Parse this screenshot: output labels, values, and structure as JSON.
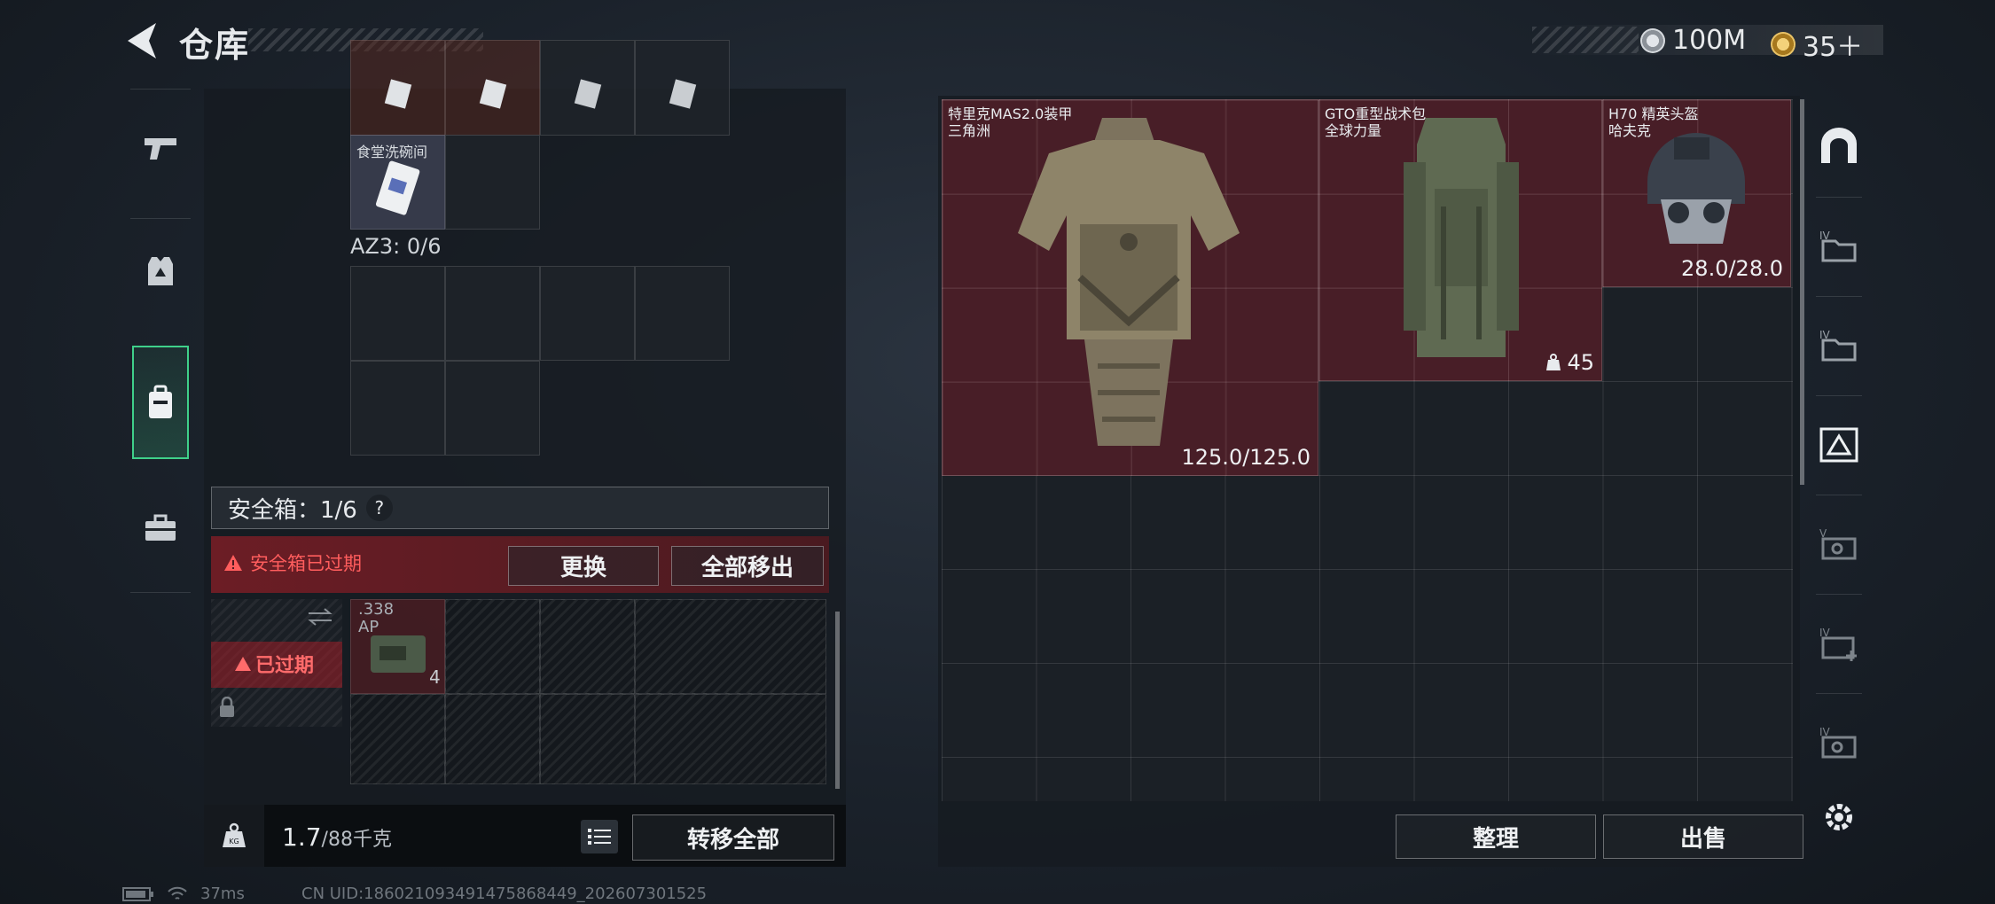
{
  "header": {
    "title": "仓库"
  },
  "currency": {
    "silver": "100M",
    "gold": "35＋"
  },
  "left_panel": {
    "item_dish": {
      "name": "食堂洗碗间"
    },
    "az3_label": "AZ3: 0/6",
    "safe_box": {
      "label": "安全箱：1/6",
      "help": "?"
    },
    "warning": {
      "text": "安全箱已过期",
      "replace": "更换",
      "move_all_out": "全部移出"
    },
    "expired_badge": "已过期",
    "ammo": {
      "label_line1": ".338",
      "label_line2": "AP",
      "count": "4"
    },
    "weight": {
      "value": "1.7",
      "unit": "/88千克"
    },
    "transfer_all": "转移全部"
  },
  "storage": {
    "items": [
      {
        "name": "特里克MAS2.0装甲",
        "sub": "三角洲",
        "durability": "125.0/125.0"
      },
      {
        "name": "GTO重型战术包",
        "sub": "全球力量",
        "count": "45"
      },
      {
        "name": "H70 精英头盔",
        "sub": "哈夫克",
        "durability": "28.0/28.0"
      }
    ],
    "organize": "整理",
    "sell": "出售"
  },
  "right_tabs": [
    "vault-icon",
    "folder-4-icon",
    "folder-4b-icon",
    "expand-icon",
    "photo-5-icon",
    "add-4-icon",
    "photo-4-icon"
  ],
  "status": {
    "ping": "37ms",
    "uid": "CN UID:1860210934914758684​49_202607301525"
  },
  "colors": {
    "accent_green": "#3fd08a",
    "danger_red": "#ff5d5d",
    "item_red": "#6e1e28"
  }
}
